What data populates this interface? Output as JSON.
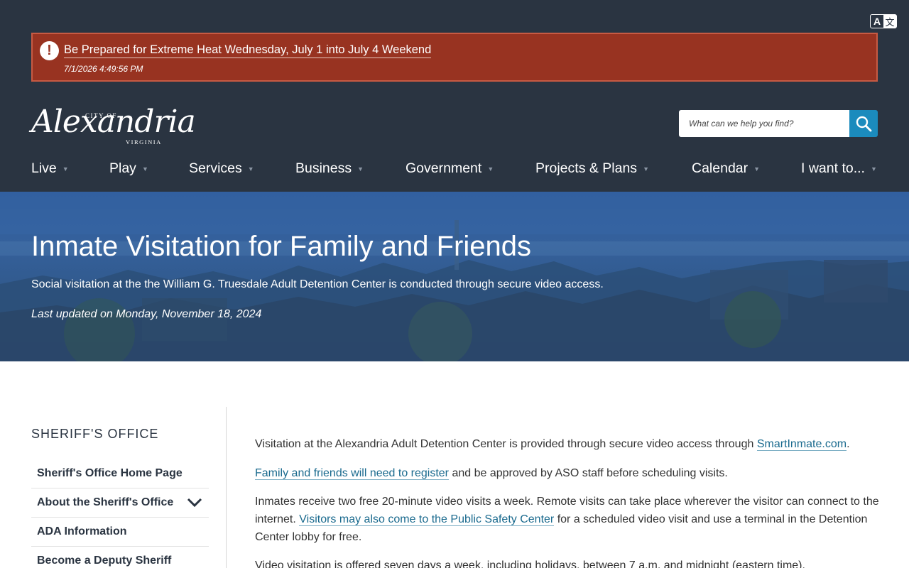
{
  "translate": {
    "icon_letter": "A",
    "icon_glyph": "文"
  },
  "alert": {
    "title": "Be Prepared for Extreme Heat Wednesday, July 1 into July 4 Weekend",
    "date": "7/1/2026 4:49:56 PM",
    "icon_glyph": "!"
  },
  "logo": {
    "city_of": "CITY OF",
    "name": "Alexandria",
    "state": "VIRGINIA"
  },
  "search": {
    "placeholder": "What can we help you find?"
  },
  "nav": [
    {
      "label": "Live"
    },
    {
      "label": "Play"
    },
    {
      "label": "Services"
    },
    {
      "label": "Business"
    },
    {
      "label": "Government"
    },
    {
      "label": "Projects & Plans"
    },
    {
      "label": "Calendar"
    },
    {
      "label": "I want to..."
    }
  ],
  "hero": {
    "title": "Inmate Visitation for Family and Friends",
    "subtitle": "Social visitation at the the William G. Truesdale Adult Detention Center is conducted through secure video access.",
    "updated": "Last updated on Monday, November 18, 2024"
  },
  "sidebar": {
    "title": "SHERIFF'S OFFICE",
    "items": [
      {
        "label": "Sheriff's Office Home Page"
      },
      {
        "label": "About the Sheriff's Office"
      },
      {
        "label": "ADA Information"
      },
      {
        "label": "Become a Deputy Sheriff"
      }
    ]
  },
  "content": {
    "p1_before": "Visitation at the Alexandria Adult Detention Center is provided through secure video access through ",
    "p1_link": "SmartInmate.com",
    "p1_after": ".",
    "p2_link": "Family and friends will need to register",
    "p2_after": " and be approved by ASO staff before scheduling visits.",
    "p3_before": "Inmates receive two free 20-minute video visits a week. Remote visits can take place wherever the visitor can connect to the internet. ",
    "p3_link": "Visitors may also come to the Public Safety Center",
    "p3_after": " for a scheduled video visit and use a terminal in the Detention Center lobby for free.",
    "p4": "Video visitation is offered seven days a week, including holidays, between 7 a.m. and midnight (eastern time)."
  },
  "colors": {
    "header_bg": "#2a3441",
    "alert_bg": "#983321",
    "search_button": "#1b8bbd",
    "link": "#1a6a8e",
    "hero_blue": "#2e5a99"
  }
}
